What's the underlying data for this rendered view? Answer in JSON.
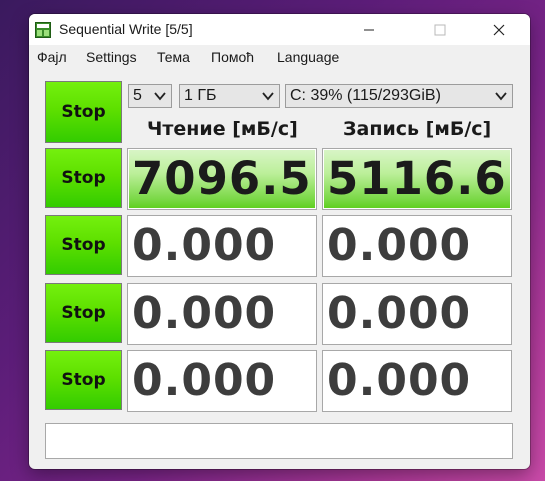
{
  "window": {
    "title": "Sequential Write [5/5]"
  },
  "menu": [
    "Фајл",
    "Settings",
    "Тема",
    "Помоћ",
    "Language"
  ],
  "controls": {
    "count": "5",
    "size": "1 ГБ",
    "drive": "C: 39% (115/293GiB)"
  },
  "headers": {
    "read": "Чтение [мБ/с]",
    "write": "Запись [мБ/с]"
  },
  "stop_label": "Stop",
  "rows": [
    {
      "read": "7096.5",
      "write": "5116.6",
      "read_fill": 1.0,
      "write_fill": 1.0
    },
    {
      "read": "0.000",
      "write": "0.000",
      "read_fill": 0,
      "write_fill": 0
    },
    {
      "read": "0.000",
      "write": "0.000",
      "read_fill": 0,
      "write_fill": 0
    },
    {
      "read": "0.000",
      "write": "0.000",
      "read_fill": 0,
      "write_fill": 0
    }
  ],
  "status": "",
  "colors": {
    "stop_button": "#5ee000",
    "bar_fill": "#7ad846"
  }
}
